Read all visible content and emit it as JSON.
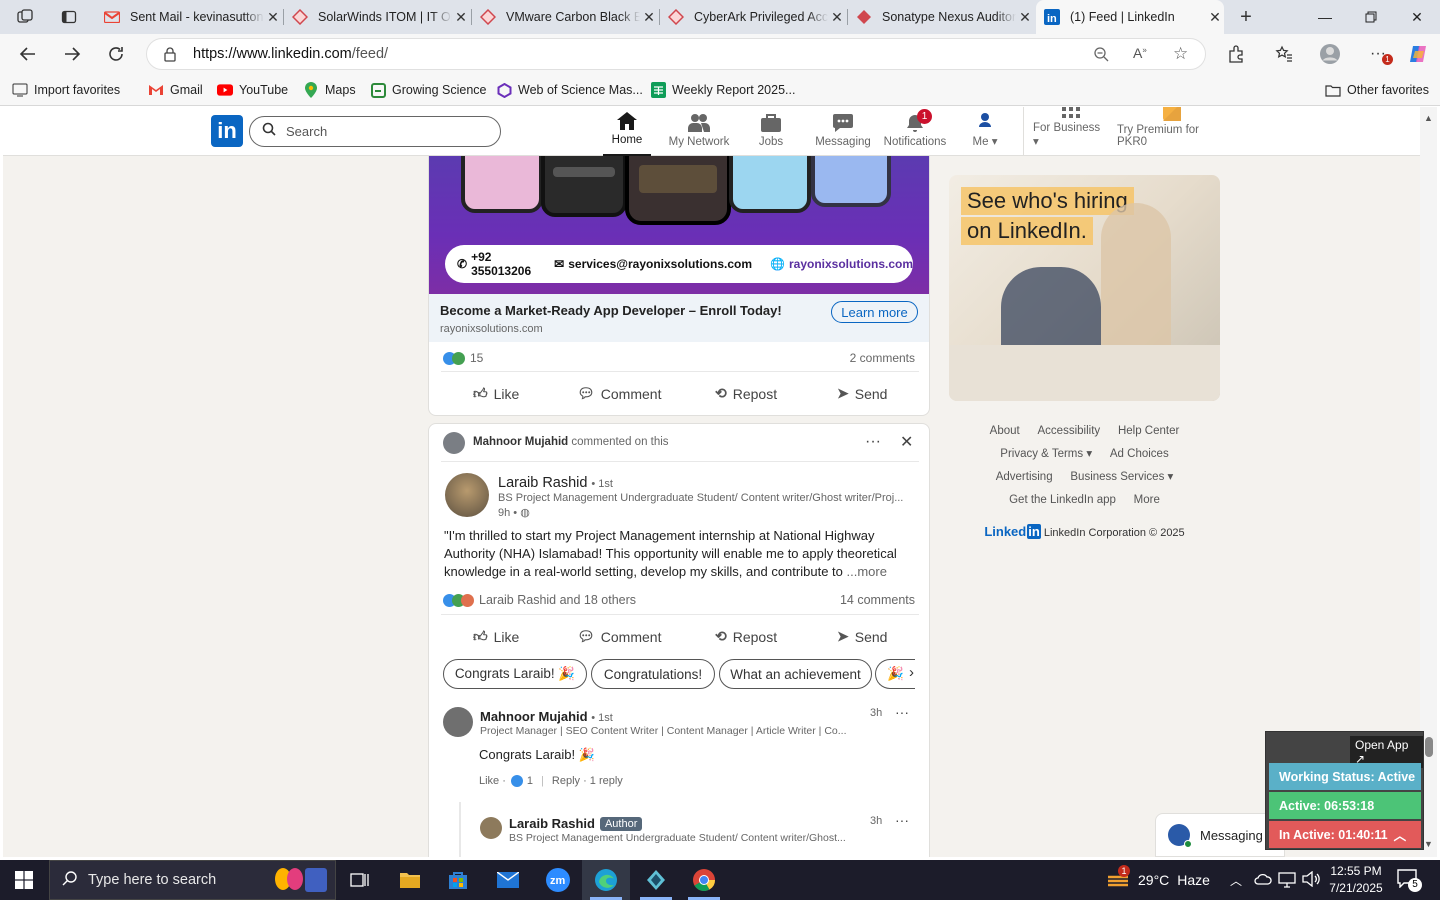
{
  "browser": {
    "tabs": [
      {
        "title": "Sent Mail - kevinasutton",
        "icon": "gmail-icon",
        "active": false
      },
      {
        "title": "SolarWinds ITOM | IT Ops",
        "icon": "diamond-icon",
        "active": false
      },
      {
        "title": "VMware Carbon Black EDR",
        "icon": "diamond-icon",
        "active": false
      },
      {
        "title": "CyberArk Privileged Access",
        "icon": "diamond-icon",
        "active": false
      },
      {
        "title": "Sonatype Nexus Auditor",
        "icon": "diamond-icon",
        "active": false
      },
      {
        "title": "(1) Feed | LinkedIn",
        "icon": "linkedin-icon",
        "active": true
      }
    ],
    "url_host": "https://www.linkedin.com",
    "url_path": "/feed/",
    "favorites": [
      {
        "label": "Import favorites"
      },
      {
        "label": "Gmail"
      },
      {
        "label": "YouTube"
      },
      {
        "label": "Maps"
      },
      {
        "label": "Growing Science"
      },
      {
        "label": "Web of Science Mas..."
      },
      {
        "label": "Weekly Report 2025..."
      }
    ],
    "other_favorites": "Other favorites",
    "accent": "#0a66c2"
  },
  "linkedin": {
    "search_placeholder": "Search",
    "nav": [
      {
        "label": "Home",
        "icon": "home-icon",
        "active": true
      },
      {
        "label": "My Network",
        "icon": "people-icon"
      },
      {
        "label": "Jobs",
        "icon": "briefcase-icon"
      },
      {
        "label": "Messaging",
        "icon": "chat-icon"
      },
      {
        "label": "Notifications",
        "icon": "bell-icon",
        "badge": "1"
      },
      {
        "label": "Me",
        "icon": "avatar-icon"
      },
      {
        "label": "For Business",
        "icon": "grid-icon"
      },
      {
        "label": "Try Premium for PKR0",
        "icon": "premium-icon"
      }
    ]
  },
  "ad_post": {
    "phone": "+92 355013206",
    "email": "services@rayonixsolutions.com",
    "site": "rayonixsolutions.com",
    "headline": "Become a Market-Ready App Developer – Enroll Today!",
    "domain": "rayonixsolutions.com",
    "cta": "Learn more",
    "reactions": "15",
    "comments": "2 comments",
    "actions": [
      "Like",
      "Comment",
      "Repost",
      "Send"
    ]
  },
  "post2": {
    "commenter": "Mahnoor Mujahid",
    "commenter_action": "commented on this",
    "author": "Laraib Rashid",
    "degree": "• 1st",
    "headline": "BS Project Management Undergraduate Student/ Content writer/Ghost writer/Proj...",
    "time": "9h •",
    "text": "\"I'm thrilled to start my Project Management internship at National Highway Authority (NHA) Islamabad! This opportunity will enable me to apply theoretical knowledge in a real-world setting, develop my skills, and contribute to",
    "more": "...more",
    "reactions": "Laraib Rashid and 18 others",
    "comments": "14 comments",
    "actions": [
      "Like",
      "Comment",
      "Repost",
      "Send"
    ],
    "chips": [
      "Congrats Laraib! 🎉",
      "Congratulations!",
      "What an achievement",
      "🎉"
    ],
    "comment1": {
      "name": "Mahnoor Mujahid",
      "degree": "• 1st",
      "headline": "Project Manager | SEO Content Writer | Content Manager | Article Writer | Co...",
      "time": "3h",
      "text": "Congrats Laraib! 🎉",
      "like": "Like ·",
      "like_count": "1",
      "reply": "Reply · 1 reply"
    },
    "comment2": {
      "name": "Laraib Rashid",
      "badge": "Author",
      "headline": "BS Project Management Undergraduate Student/ Content writer/Ghost...",
      "time": "3h"
    }
  },
  "sidebar": {
    "ad_line1": "See who's hiring",
    "ad_line2": "on LinkedIn.",
    "footer": [
      [
        "About",
        "Accessibility",
        "Help Center"
      ],
      [
        "Privacy & Terms ▾",
        "Ad Choices"
      ],
      [
        "Advertising",
        "Business Services ▾"
      ],
      [
        "Get the LinkedIn app",
        "More"
      ]
    ],
    "brand": "Linked",
    "brand_in": "in",
    "copyright": "LinkedIn Corporation © 2025"
  },
  "messaging_label": "Messaging",
  "widget": {
    "open_app": "Open App ↗",
    "status": "Working Status: Active",
    "active": "Active: 06:53:18",
    "inactive": "In Active: 01:40:11"
  },
  "taskbar": {
    "search_placeholder": "Type here to search",
    "weather_temp": "29°C",
    "weather_desc": "Haze",
    "weather_badge": "1",
    "time": "12:55 PM",
    "date": "7/21/2025",
    "notif_count": "5"
  }
}
